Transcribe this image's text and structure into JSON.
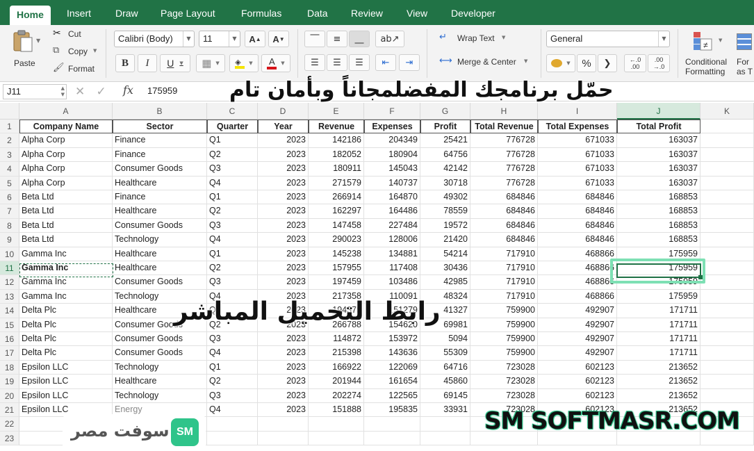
{
  "ribbon_tabs": [
    "Home",
    "Insert",
    "Draw",
    "Page Layout",
    "Formulas",
    "Data",
    "Review",
    "View",
    "Developer"
  ],
  "ribbon": {
    "paste": "Paste",
    "cut": "Cut",
    "copy": "Copy",
    "format": "Format",
    "font_name": "Calibri (Body)",
    "font_size": "11",
    "bold": "B",
    "italic": "I",
    "underline": "U",
    "wrap_text": "Wrap Text",
    "merge_center": "Merge & Center",
    "number_format": "General",
    "percent": "%",
    "comma": "❯",
    "inc_decimal": "←.0 .00",
    "dec_decimal": ".00 →.0",
    "conditional_formatting_1": "Conditional",
    "conditional_formatting_2": "Formatting",
    "format_as_1": "For",
    "format_as_2": "as T"
  },
  "formula_bar": {
    "name_box": "J11",
    "fx": "fx",
    "value": "175959"
  },
  "columns": [
    "A",
    "B",
    "C",
    "D",
    "E",
    "F",
    "G",
    "H",
    "I",
    "J",
    "K"
  ],
  "row_numbers": [
    "1",
    "2",
    "3",
    "4",
    "5",
    "6",
    "7",
    "8",
    "9",
    "10",
    "11",
    "12",
    "13",
    "14",
    "15",
    "16",
    "17",
    "18",
    "19",
    "20",
    "21",
    "22",
    "23"
  ],
  "table": {
    "headers": [
      "Company Name",
      "Sector",
      "Quarter",
      "Year",
      "Revenue",
      "Expenses",
      "Profit",
      "Total Revenue",
      "Total Expenses",
      "Total Profit"
    ],
    "rows": [
      [
        "Alpha Corp",
        "Finance",
        "Q1",
        "2023",
        "142186",
        "204349",
        "25421",
        "776728",
        "671033",
        "163037"
      ],
      [
        "Alpha Corp",
        "Finance",
        "Q2",
        "2023",
        "182052",
        "180904",
        "64756",
        "776728",
        "671033",
        "163037"
      ],
      [
        "Alpha Corp",
        "Consumer Goods",
        "Q3",
        "2023",
        "180911",
        "145043",
        "42142",
        "776728",
        "671033",
        "163037"
      ],
      [
        "Alpha Corp",
        "Healthcare",
        "Q4",
        "2023",
        "271579",
        "140737",
        "30718",
        "776728",
        "671033",
        "163037"
      ],
      [
        "Beta Ltd",
        "Finance",
        "Q1",
        "2023",
        "266914",
        "164870",
        "49302",
        "684846",
        "684846",
        "168853"
      ],
      [
        "Beta Ltd",
        "Healthcare",
        "Q2",
        "2023",
        "162297",
        "164486",
        "78559",
        "684846",
        "684846",
        "168853"
      ],
      [
        "Beta Ltd",
        "Consumer Goods",
        "Q3",
        "2023",
        "147458",
        "227484",
        "19572",
        "684846",
        "684846",
        "168853"
      ],
      [
        "Beta Ltd",
        "Technology",
        "Q4",
        "2023",
        "290023",
        "128006",
        "21420",
        "684846",
        "684846",
        "168853"
      ],
      [
        "Gamma Inc",
        "Healthcare",
        "Q1",
        "2023",
        "145238",
        "134881",
        "54214",
        "717910",
        "468866",
        "175959"
      ],
      [
        "Gamma Inc",
        "Healthcare",
        "Q2",
        "2023",
        "157955",
        "117408",
        "30436",
        "717910",
        "468866",
        "175959"
      ],
      [
        "Gamma Inc",
        "Consumer Goods",
        "Q3",
        "2023",
        "197459",
        "103486",
        "42985",
        "717910",
        "468866",
        "175959"
      ],
      [
        "Gamma Inc",
        "Technology",
        "Q4",
        "2023",
        "217358",
        "110091",
        "48324",
        "717910",
        "468866",
        "175959"
      ],
      [
        "Delta Plc",
        "Healthcare",
        "Q1",
        "2023",
        "194379",
        "151279",
        "41327",
        "759900",
        "492907",
        "171711"
      ],
      [
        "Delta Plc",
        "Consumer Goods",
        "Q2",
        "2023",
        "266788",
        "154620",
        "69981",
        "759900",
        "492907",
        "171711"
      ],
      [
        "Delta Plc",
        "Consumer Goods",
        "Q3",
        "2023",
        "114872",
        "153972",
        "5094",
        "759900",
        "492907",
        "171711"
      ],
      [
        "Delta Plc",
        "Consumer Goods",
        "Q4",
        "2023",
        "215398",
        "143636",
        "55309",
        "759900",
        "492907",
        "171711"
      ],
      [
        "Epsilon LLC",
        "Technology",
        "Q1",
        "2023",
        "166922",
        "122069",
        "64716",
        "723028",
        "602123",
        "213652"
      ],
      [
        "Epsilon LLC",
        "Healthcare",
        "Q2",
        "2023",
        "201944",
        "161654",
        "45860",
        "723028",
        "602123",
        "213652"
      ],
      [
        "Epsilon LLC",
        "Technology",
        "Q3",
        "2023",
        "202274",
        "122565",
        "69145",
        "723028",
        "602123",
        "213652"
      ],
      [
        "Epsilon LLC",
        "Energy",
        "Q4",
        "2023",
        "151888",
        "195835",
        "33931",
        "723028",
        "602123",
        "213652"
      ]
    ]
  },
  "overlay": {
    "top_banner": "حمّل برنامجك المفضلمجاناً وبأمان تام",
    "mid_banner": "رابط التحميل المباشر",
    "brand_en": "SM SOFTMASR.COM",
    "brand_ar": "سوفت مصر",
    "brand_badge": "SM"
  },
  "colors": {
    "excel_green": "#217346",
    "selection": "#1e7145",
    "badge": "#2fc48a"
  }
}
